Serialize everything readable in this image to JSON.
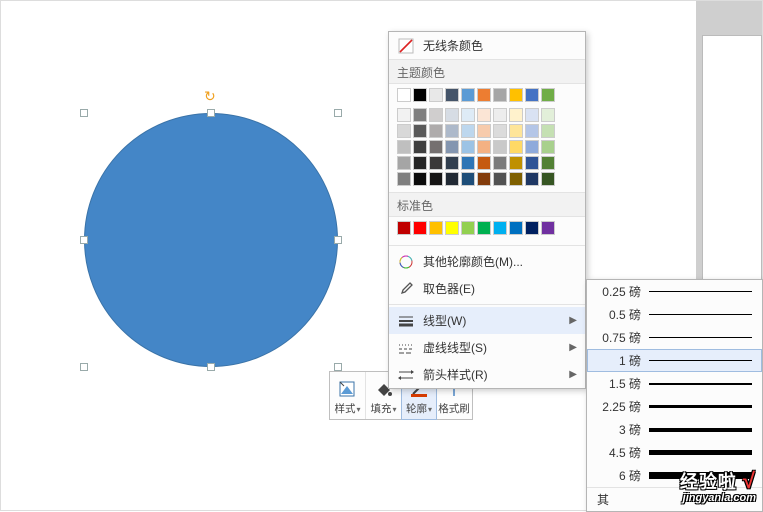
{
  "toolbar": {
    "style_label": "样式",
    "fill_label": "填充",
    "outline_label": "轮廓",
    "brush_label": "格式刷"
  },
  "menu": {
    "no_line_color": "无线条颜色",
    "theme_colors_hdr": "主题颜色",
    "standard_colors_hdr": "标准色",
    "more_colors": "其他轮廓颜色(M)...",
    "picker": "取色器(E)",
    "line_style": "线型(W)",
    "dash_style": "虚线线型(S)",
    "arrow_style": "箭头样式(R)"
  },
  "theme_row": [
    "#ffffff",
    "#000000",
    "#e8e8e8",
    "#445469",
    "#5b9bd5",
    "#ed7d31",
    "#a5a5a5",
    "#ffc000",
    "#4472c4",
    "#70ad47"
  ],
  "theme_shades": [
    [
      "#f2f2f2",
      "#7f7f7f",
      "#d0cece",
      "#d6dce4",
      "#deebf6",
      "#fbe5d5",
      "#ededed",
      "#fff2cc",
      "#d9e2f3",
      "#e2efd9"
    ],
    [
      "#d8d8d8",
      "#595959",
      "#aeabab",
      "#adb9ca",
      "#bdd7ee",
      "#f7cbac",
      "#dbdbdb",
      "#fee599",
      "#b4c6e7",
      "#c5e0b3"
    ],
    [
      "#bfbfbf",
      "#3f3f3f",
      "#757070",
      "#8496b0",
      "#9cc3e5",
      "#f4b183",
      "#c9c9c9",
      "#ffd965",
      "#8eaadb",
      "#a8d08d"
    ],
    [
      "#a5a5a5",
      "#262626",
      "#3a3838",
      "#323f4f",
      "#2e75b5",
      "#c55a11",
      "#7b7b7b",
      "#bf9000",
      "#2f5496",
      "#538135"
    ],
    [
      "#7f7f7f",
      "#0c0c0c",
      "#171616",
      "#222a35",
      "#1e4e79",
      "#833c0b",
      "#525252",
      "#7f6000",
      "#1f3864",
      "#375623"
    ]
  ],
  "standard_colors": [
    "#c00000",
    "#ff0000",
    "#ffc000",
    "#ffff00",
    "#92d050",
    "#00b050",
    "#00b0f0",
    "#0070c0",
    "#002060",
    "#7030a0"
  ],
  "line_weights": [
    {
      "label": "0.25 磅",
      "h": 0.5
    },
    {
      "label": "0.5 磅",
      "h": 1
    },
    {
      "label": "0.75 磅",
      "h": 1
    },
    {
      "label": "1 磅",
      "h": 1.5,
      "selected": true
    },
    {
      "label": "1.5 磅",
      "h": 2
    },
    {
      "label": "2.25 磅",
      "h": 3
    },
    {
      "label": "3 磅",
      "h": 4
    },
    {
      "label": "4.5 磅",
      "h": 5.5
    },
    {
      "label": "6 磅",
      "h": 7
    }
  ],
  "submenu_tail": "其",
  "watermark": {
    "line1_a": "经验啦",
    "line1_b": "√",
    "line2": "jingyanla.com"
  },
  "shape": {
    "fill": "#4486c7"
  }
}
